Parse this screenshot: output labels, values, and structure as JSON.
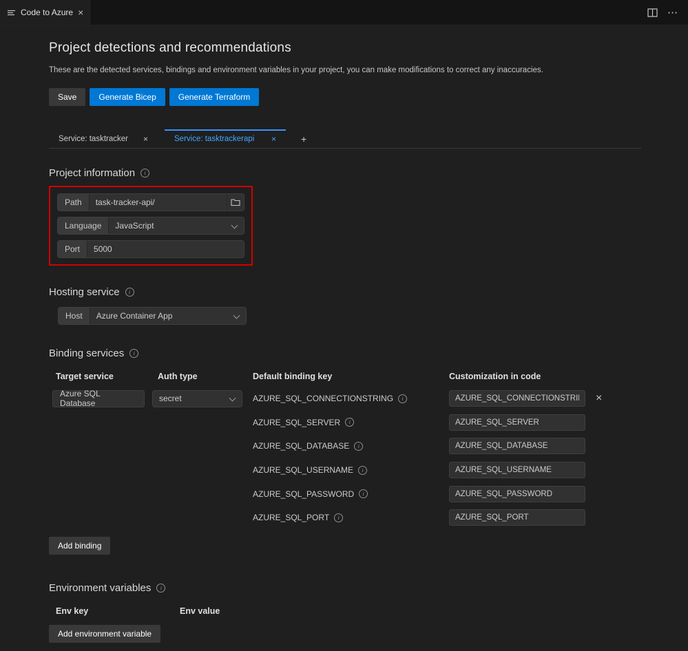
{
  "window": {
    "editor_tab_title": "Code to Azure",
    "icons": {
      "close": "×",
      "more": "⋯"
    }
  },
  "page": {
    "title": "Project detections and recommendations",
    "subtitle": "These are the detected services, bindings and environment variables in your project, you can make modifications to correct any inaccuracies."
  },
  "toolbar": {
    "save": "Save",
    "generate_bicep": "Generate Bicep",
    "generate_terraform": "Generate Terraform"
  },
  "service_tabs": {
    "tab1": {
      "label": "Service: tasktracker",
      "close": "×"
    },
    "tab2": {
      "label": "Service: tasktrackerapi",
      "close": "×"
    },
    "add": "+"
  },
  "project_information": {
    "heading": "Project information",
    "path_label": "Path",
    "path_value": "task-tracker-api/",
    "language_label": "Language",
    "language_value": "JavaScript",
    "port_label": "Port",
    "port_value": "5000"
  },
  "hosting_service": {
    "heading": "Hosting service",
    "host_label": "Host",
    "host_value": "Azure Container App"
  },
  "binding_services": {
    "heading": "Binding services",
    "col_target_service": "Target service",
    "col_auth_type": "Auth type",
    "col_default_binding_key": "Default binding key",
    "col_customization": "Customization in code",
    "target_service_value": "Azure SQL Database",
    "auth_type_value": "secret",
    "remove": "×",
    "keys": [
      {
        "name": "AZURE_SQL_CONNECTIONSTRING",
        "custom": "AZURE_SQL_CONNECTIONSTRING"
      },
      {
        "name": "AZURE_SQL_SERVER",
        "custom": "AZURE_SQL_SERVER"
      },
      {
        "name": "AZURE_SQL_DATABASE",
        "custom": "AZURE_SQL_DATABASE"
      },
      {
        "name": "AZURE_SQL_USERNAME",
        "custom": "AZURE_SQL_USERNAME"
      },
      {
        "name": "AZURE_SQL_PASSWORD",
        "custom": "AZURE_SQL_PASSWORD"
      },
      {
        "name": "AZURE_SQL_PORT",
        "custom": "AZURE_SQL_PORT"
      }
    ],
    "add_binding": "Add binding"
  },
  "environment_variables": {
    "heading": "Environment variables",
    "col_env_key": "Env key",
    "col_env_value": "Env value",
    "add_env": "Add environment variable"
  },
  "colors": {
    "accent_blue": "#0078d4",
    "active_tab_blue": "#3794ff",
    "highlight_red": "#d40000"
  }
}
